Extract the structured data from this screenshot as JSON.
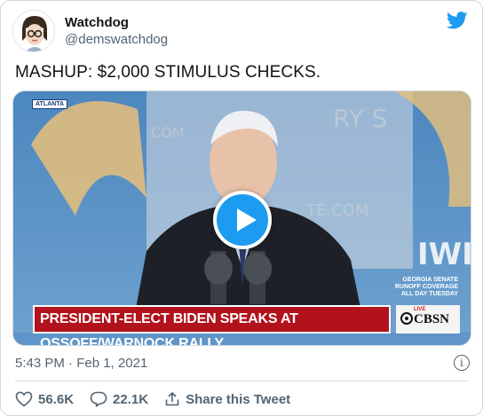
{
  "tweet": {
    "display_name": "Watchdog",
    "handle": "@demswatchdog",
    "text": "MASHUP: $2,000 STIMULUS CHECKS.",
    "timestamp": "5:43 PM · Feb 1, 2021"
  },
  "video": {
    "location_tag": "ATLANTA",
    "coverage_lines": [
      "GEORGIA SENATE",
      "RUNOFF COVERAGE",
      "ALL DAY TUESDAY"
    ],
    "headline": "PRESIDENT-ELECT BIDEN SPEAKS AT OSSOFF/WARNOCK RALLY",
    "network": "CBSN",
    "live_label": "LIVE"
  },
  "actions": {
    "likes": "56.6K",
    "replies": "22.1K",
    "share_label": "Share this Tweet"
  },
  "colors": {
    "twitter_blue": "#1d9bf0",
    "secondary_text": "#536471",
    "lower_third_red": "#b1121b"
  }
}
